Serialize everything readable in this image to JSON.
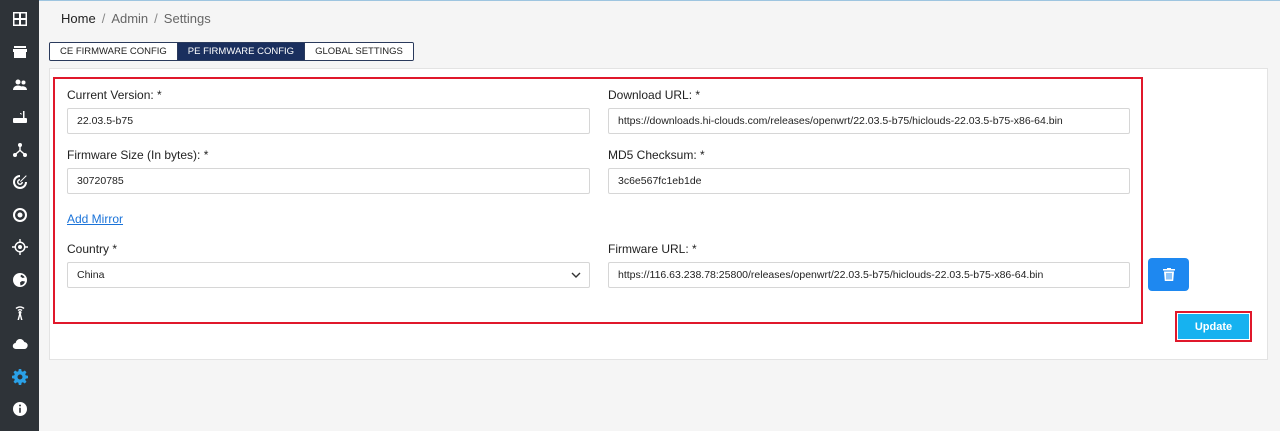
{
  "sidebar": {
    "items": [
      {
        "icon": "dashboard-grid-icon"
      },
      {
        "icon": "store-icon"
      },
      {
        "icon": "users-icon"
      },
      {
        "icon": "router-icon"
      },
      {
        "icon": "network-topology-icon"
      },
      {
        "icon": "radar-icon"
      },
      {
        "icon": "target-circle-icon"
      },
      {
        "icon": "crosshair-location-icon"
      },
      {
        "icon": "globe-icon"
      },
      {
        "icon": "wireless-tower-icon"
      },
      {
        "icon": "cloud-icon"
      },
      {
        "icon": "gear-icon",
        "active": true
      },
      {
        "icon": "info-icon"
      }
    ],
    "active_color": "#2aa1e8"
  },
  "breadcrumb": {
    "home": "Home",
    "sep1": "/",
    "admin": "Admin",
    "sep2": "/",
    "settings": "Settings"
  },
  "tabs": {
    "ce": "CE FIRMWARE CONFIG",
    "pe": "PE FIRMWARE CONFIG",
    "global": "GLOBAL SETTINGS"
  },
  "form": {
    "current_version_label": "Current Version: *",
    "current_version_value": "22.03.5-b75",
    "download_url_label": "Download URL: *",
    "download_url_value": "https://downloads.hi-clouds.com/releases/openwrt/22.03.5-b75/hiclouds-22.03.5-b75-x86-64.bin",
    "firmware_size_label": "Firmware Size (In bytes): *",
    "firmware_size_value": "30720785",
    "md5_label": "MD5 Checksum: *",
    "md5_value": "3c6e567fc1eb1de",
    "add_mirror": "Add Mirror",
    "country_label": "Country *",
    "country_value": "China",
    "firmware_url_label": "Firmware URL: *",
    "firmware_url_value": "https://116.63.238.78:25800/releases/openwrt/22.03.5-b75/hiclouds-22.03.5-b75-x86-64.bin"
  },
  "actions": {
    "update": "Update"
  },
  "colors": {
    "highlight": "#e0182b",
    "primary_blue": "#1e88f0",
    "update_bg": "#16b2f0",
    "tab_active": "#1a2f5e"
  }
}
